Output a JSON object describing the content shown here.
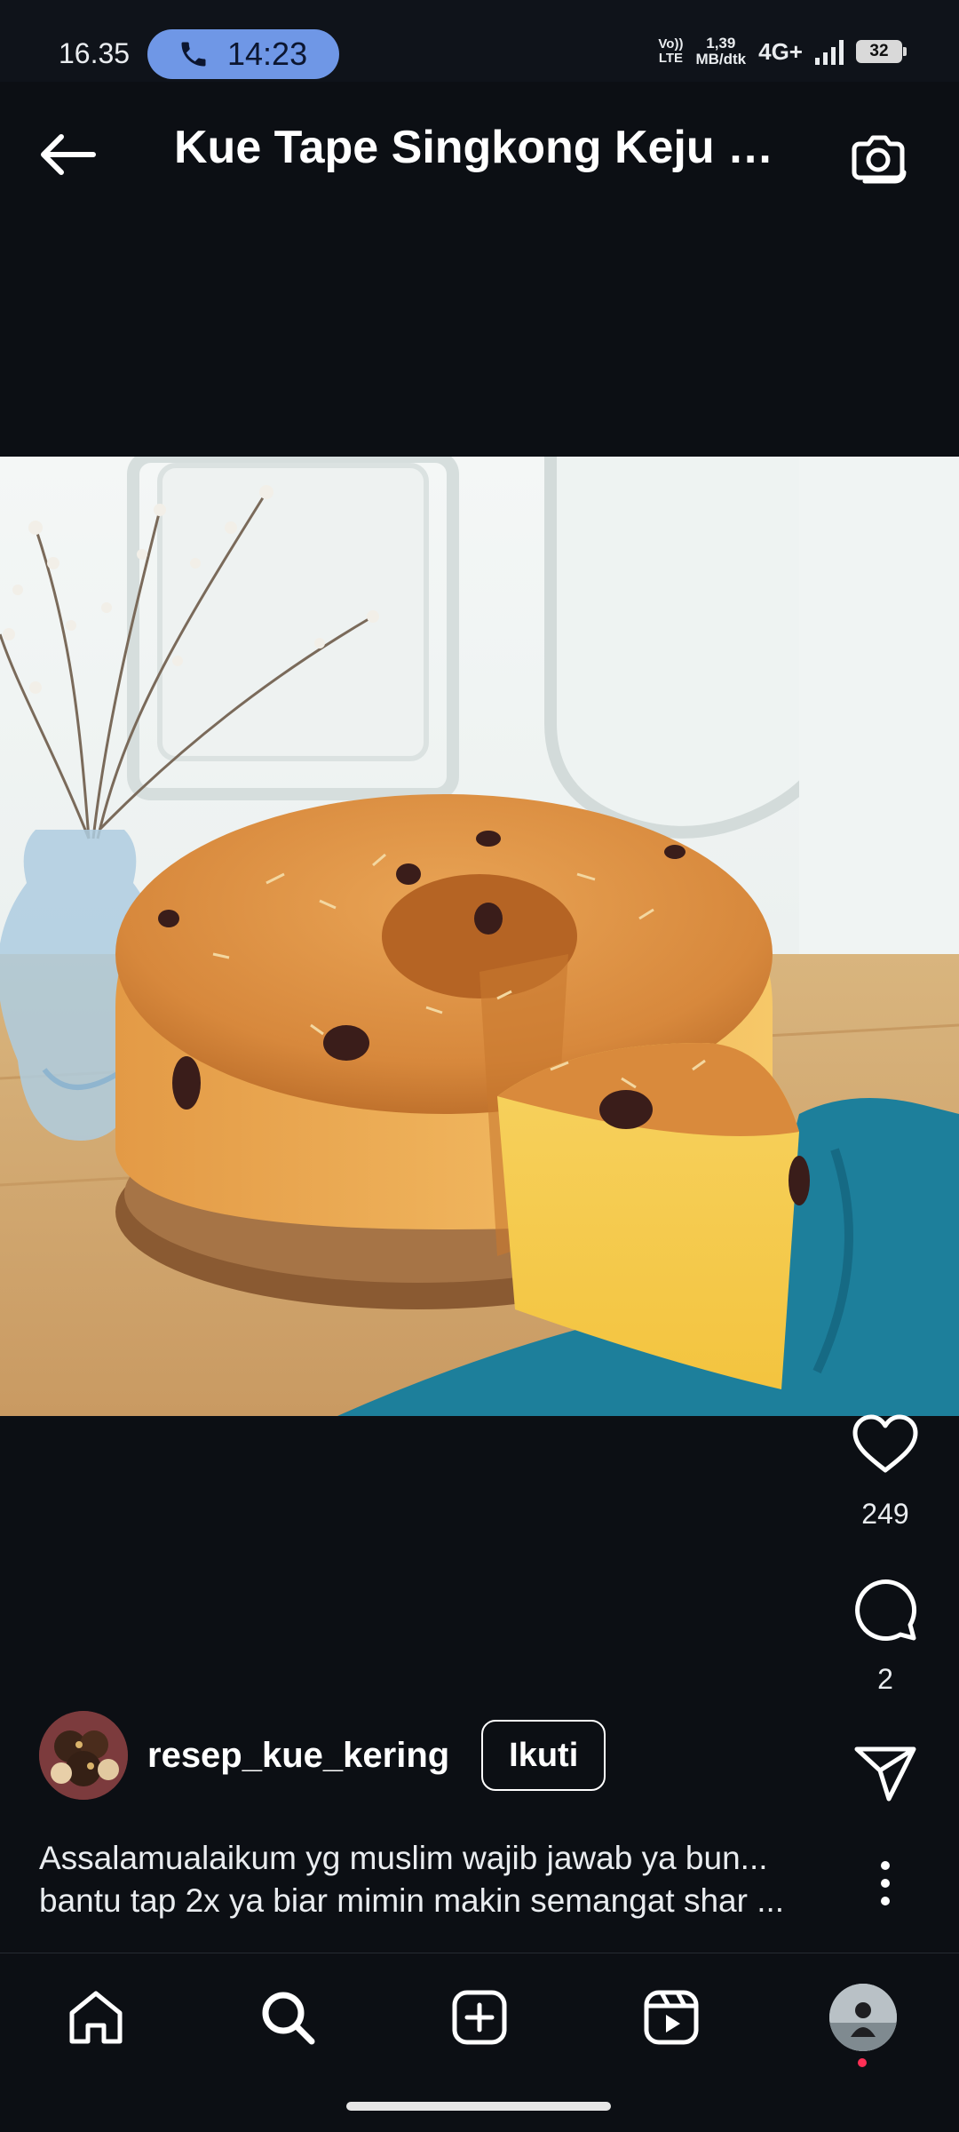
{
  "status_bar": {
    "time": "16.35",
    "call_timer": "14:23",
    "volte_line1": "Vo))",
    "volte_line2": "LTE",
    "speed_value": "1,39",
    "speed_unit": "MB/dtk",
    "network": "4G+",
    "battery": "32"
  },
  "header": {
    "title": "Kue Tape Singkong Keju K..."
  },
  "post": {
    "likes": "249",
    "comments": "2",
    "author": "resep_kue_kering",
    "follow_label": "Ikuti",
    "caption_line1": "Assalamualaikum yg muslim wajib jawab ya bun...",
    "caption_line2": "bantu tap 2x ya biar mimin makin semangat shar ..."
  },
  "icons": {
    "back": "arrow-left-icon",
    "camera": "camera-icon",
    "like": "heart-icon",
    "comment": "comment-icon",
    "share": "send-icon",
    "more": "more-vertical-icon",
    "nav": [
      "home-icon",
      "search-icon",
      "create-icon",
      "reels-icon",
      "profile-avatar"
    ]
  },
  "colors": {
    "background": "#0c0f14",
    "call_pill": "#6f97e6",
    "notification_dot": "#ff2f55"
  }
}
